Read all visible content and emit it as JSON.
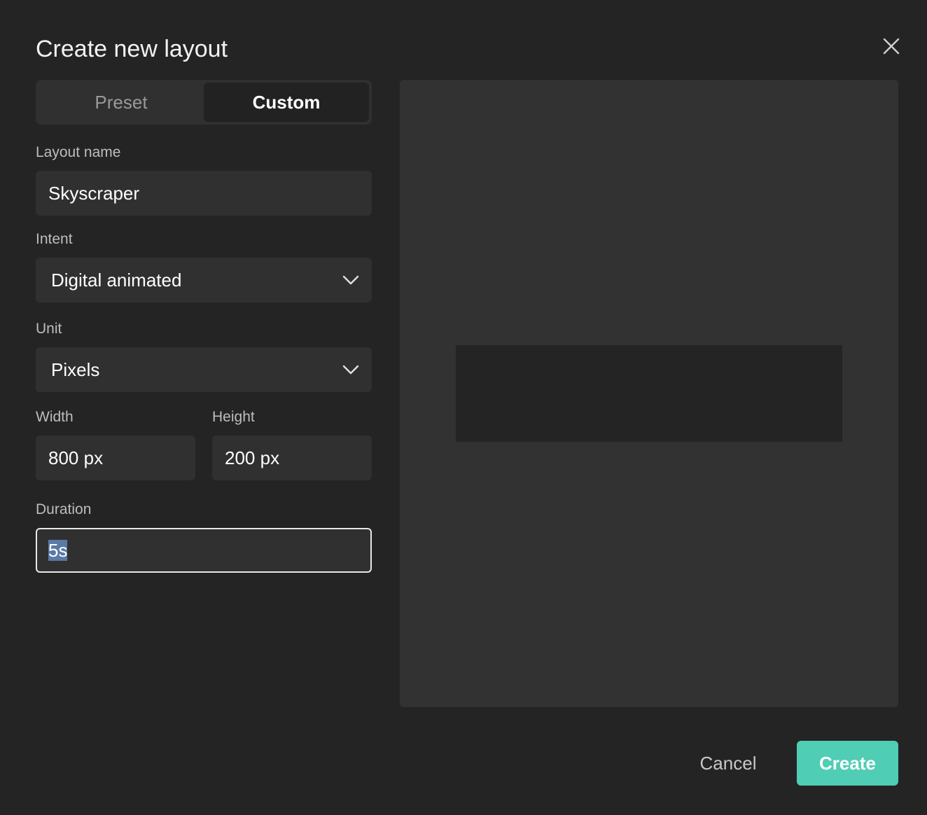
{
  "dialog": {
    "title": "Create new layout",
    "close_icon": "close-icon"
  },
  "tabs": {
    "preset_label": "Preset",
    "custom_label": "Custom",
    "active": "Custom"
  },
  "form": {
    "layout_name": {
      "label": "Layout name",
      "value": "Skyscraper"
    },
    "intent": {
      "label": "Intent",
      "value": "Digital animated",
      "icon": "chevron-down-icon"
    },
    "unit": {
      "label": "Unit",
      "value": "Pixels",
      "icon": "chevron-down-icon"
    },
    "width": {
      "label": "Width",
      "value": "800 px"
    },
    "height": {
      "label": "Height",
      "value": "200 px"
    },
    "duration": {
      "label": "Duration",
      "value": "5s"
    }
  },
  "actions": {
    "cancel_label": "Cancel",
    "create_label": "Create"
  },
  "colors": {
    "background": "#242424",
    "field": "#303030",
    "preview": "#323232",
    "accent": "#4fcdb5",
    "selection": "#5a7aa6"
  }
}
